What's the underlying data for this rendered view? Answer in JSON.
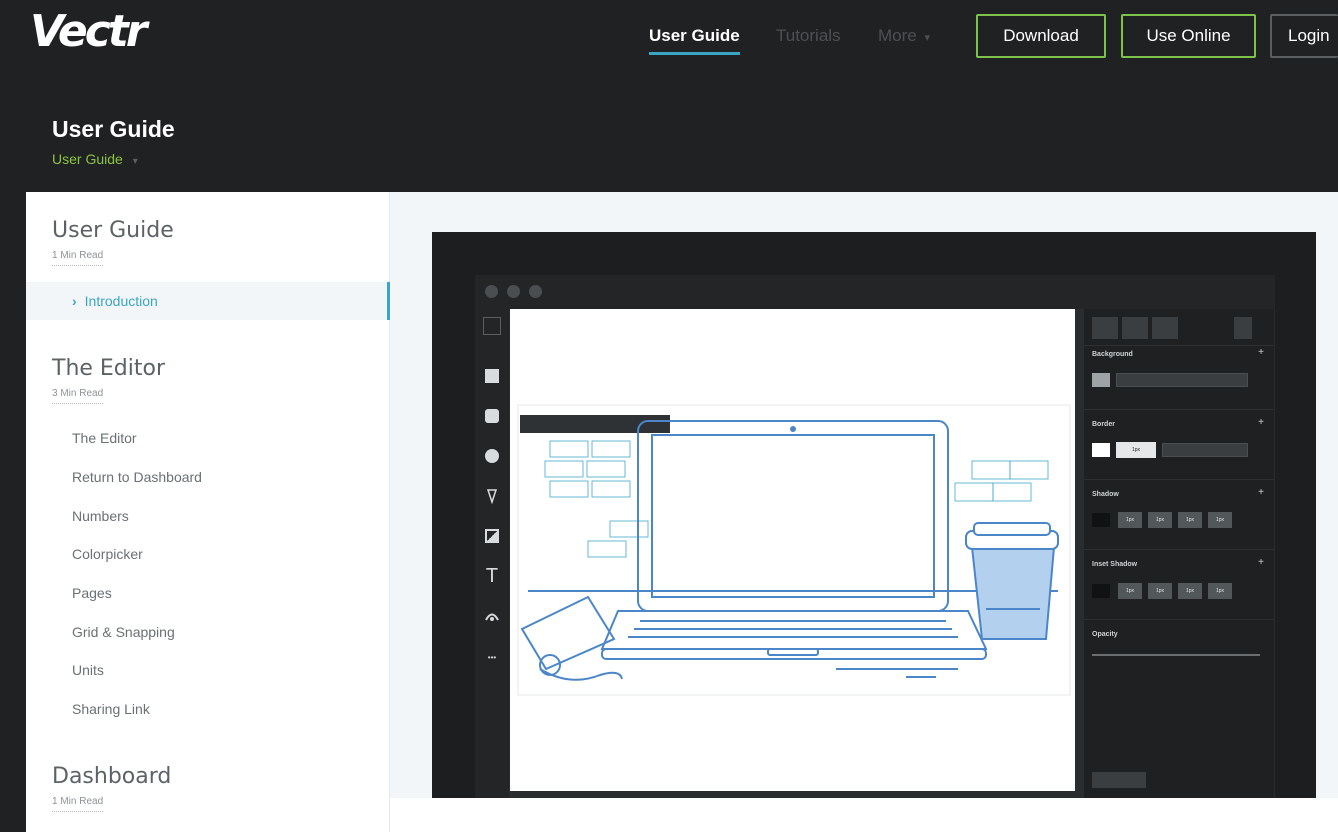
{
  "brand": {
    "logo": "Vectr"
  },
  "nav": {
    "links": [
      "User Guide",
      "Tutorials",
      "More"
    ],
    "more_caret": "▾",
    "buttons": {
      "download": "Download",
      "use_online": "Use Online",
      "login": "Login"
    }
  },
  "header": {
    "title": "User Guide",
    "breadcrumb": "User Guide",
    "breadcrumb_caret": "▾"
  },
  "sidebar": {
    "sections": [
      {
        "title": "User Guide",
        "read": "1 Min Read"
      },
      {
        "title": "The Editor",
        "read": "3 Min Read"
      },
      {
        "title": "Dashboard",
        "read": "1 Min Read"
      }
    ],
    "active_item": "Introduction",
    "editor_items": [
      "The Editor",
      "Return to Dashboard",
      "Numbers",
      "Colorpicker",
      "Pages",
      "Grid & Snapping",
      "Units",
      "Sharing Link"
    ]
  },
  "editor": {
    "tool_icons": [
      "select-icon",
      "rectangle-icon",
      "rounded-rectangle-icon",
      "ellipse-icon",
      "pen-icon",
      "image-icon",
      "text-icon",
      "path-icon",
      "more-icon"
    ],
    "text_tool_glyph": "T",
    "more_glyph": "•••",
    "panel": {
      "sections": [
        "Background",
        "Border",
        "Shadow",
        "Inset Shadow",
        "Opacity"
      ],
      "plus_glyph": "+",
      "border_value": "1px",
      "shadow_values": [
        "1px",
        "1px",
        "1px",
        "1px"
      ],
      "inset_values": [
        "1px",
        "1px",
        "1px",
        "1px"
      ]
    }
  },
  "colors": {
    "accent": "#3ba6c4",
    "green": "#8cc53f",
    "dark": "#1f2122",
    "illustration": "#4a86c8"
  }
}
